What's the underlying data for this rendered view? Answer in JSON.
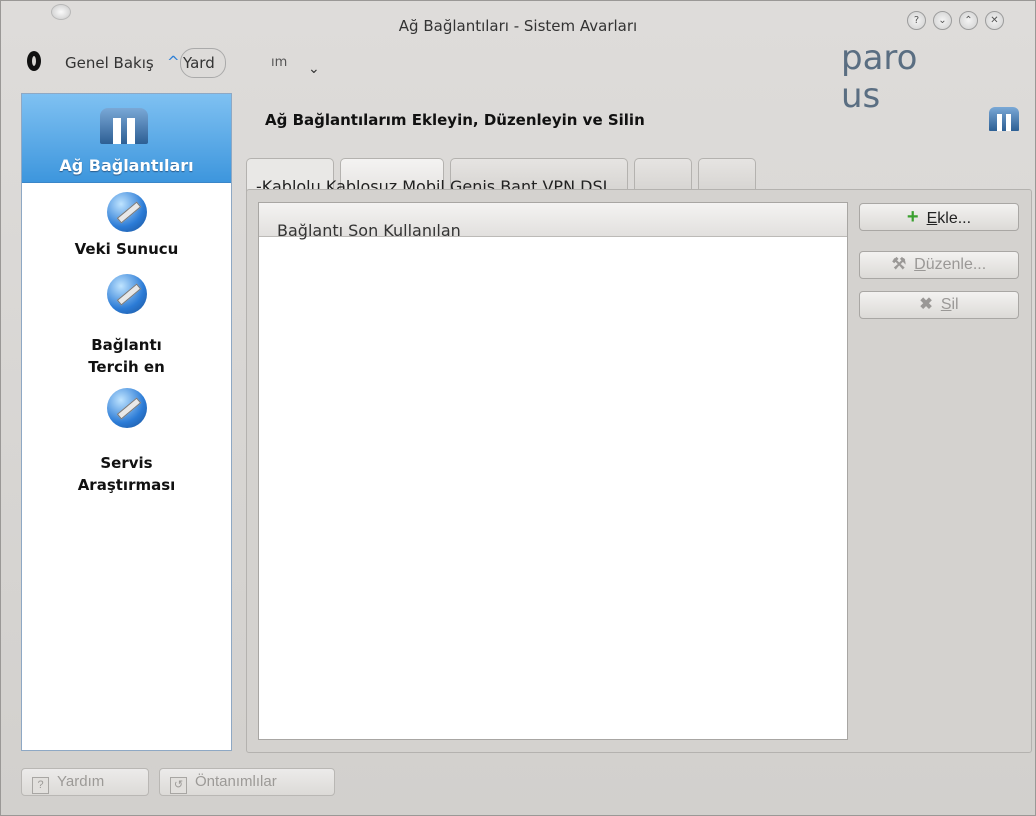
{
  "window": {
    "title": "Ağ Bağlantıları - Sistem Avarları",
    "controls": [
      {
        "name": "help",
        "glyph": "?"
      },
      {
        "name": "minimize",
        "glyph": "⌄"
      },
      {
        "name": "maximize",
        "glyph": "⌃"
      },
      {
        "name": "close",
        "glyph": "✕"
      }
    ]
  },
  "toolbar": {
    "overview_label": "Genel Bakış",
    "caret": "^",
    "help_label": "Yard",
    "menu_label": "ım",
    "chevron": "⌄",
    "logo_line1": "paro",
    "logo_line2": "us"
  },
  "sidebar": {
    "selected_label": "Ağ Bağlantıları",
    "items": [
      {
        "label_line1": "Veki Sunucu",
        "label_line2": ""
      },
      {
        "label_line1": "Bağlantı",
        "label_line2": "Tercih en"
      },
      {
        "label_line1": "Servis",
        "label_line2": "Araştırması"
      }
    ]
  },
  "main": {
    "heading": "Ağ Bağlantılarım Ekleyin, Düzenleyin ve Silin",
    "tabs_label": "-Kablolu Kablosuz Mobil Geniş Bant VPN DSL",
    "list_header": "Bağlantı Son Kullanılan"
  },
  "actions": {
    "add_prefix": "E",
    "add_rest": "kle...",
    "edit_prefix": "D",
    "edit_rest": "üzenle...",
    "delete_prefix": "S",
    "delete_rest": "il"
  },
  "footer": {
    "help_label": "Yardım",
    "defaults_label": "Öntanımlılar"
  }
}
